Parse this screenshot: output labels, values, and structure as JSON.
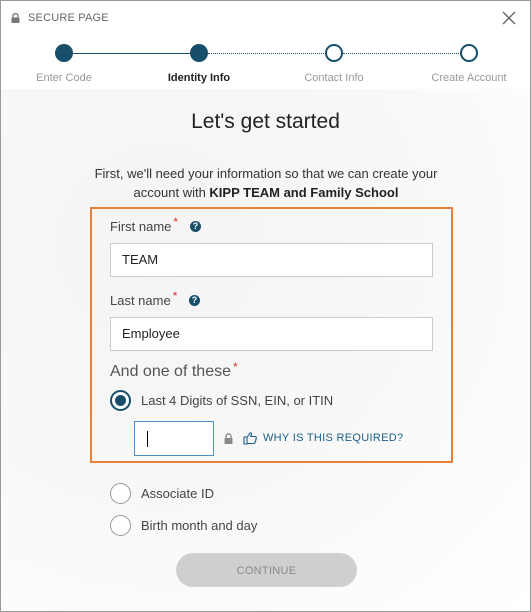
{
  "header": {
    "secure_label": "SECURE PAGE",
    "icons": {
      "lock": "lock-icon",
      "close": "close-icon"
    }
  },
  "stepper": {
    "steps": [
      {
        "label": "Enter Code",
        "state": "done"
      },
      {
        "label": "Identity Info",
        "state": "current"
      },
      {
        "label": "Contact Info",
        "state": "todo"
      },
      {
        "label": "Create Account",
        "state": "todo"
      }
    ]
  },
  "main": {
    "heading": "Let's get started",
    "intro_line1": "First, we'll need your information so that we can create your",
    "intro_line2_prefix": "account with ",
    "intro_line2_org": "KIPP TEAM and Family School"
  },
  "form": {
    "first_name_label": "First name",
    "first_name_value": "TEAM",
    "last_name_label": "Last name",
    "last_name_value": "Employee",
    "required_marker": "*",
    "help_glyph": "?",
    "one_of_label": "And one of these",
    "options": [
      {
        "label": "Last 4 Digits of SSN, EIN, or ITIN",
        "selected": true
      },
      {
        "label": "Associate ID",
        "selected": false
      },
      {
        "label": "Birth month and day",
        "selected": false
      }
    ],
    "ssn_value": "",
    "why_link": "WHY IS THIS REQUIRED?",
    "continue_label": "CONTINUE"
  },
  "colors": {
    "primary": "#174f6b",
    "highlight_border": "#e87f38",
    "required": "#d9342b",
    "link": "#1b5f88",
    "disabled_button": "#cfcfcf"
  }
}
